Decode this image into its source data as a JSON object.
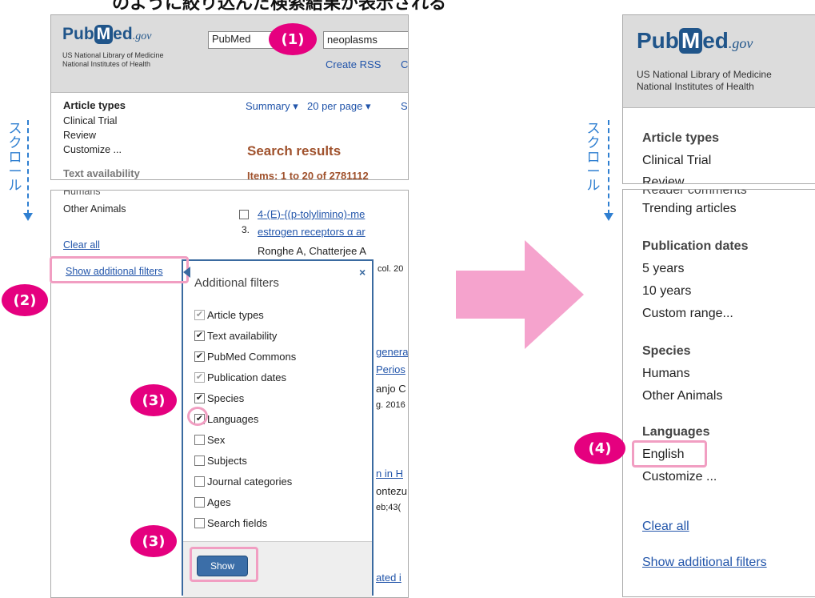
{
  "caption": "のように絞り込んだ検索結果が表示される",
  "left": {
    "logo": {
      "pub": "Pub",
      "m": "M",
      "ed": "ed",
      "gov": ".gov"
    },
    "nlm_line1": "US National Library of Medicine",
    "nlm_line2": "National Institutes of Health",
    "db_select": "PubMed",
    "search_value": "neoplasms",
    "create_rss": "Create RSS",
    "create_rss_cut": "C",
    "sidebar": {
      "article_types": "Article types",
      "clinical_trial": "Clinical Trial",
      "review": "Review",
      "customize": "Customize ...",
      "humans": "Humans",
      "other_animals": "Other Animals",
      "clear_all": "Clear all",
      "show_additional_filters": "Show additional filters"
    },
    "toolbar": {
      "summary": "Summary",
      "per_page": "20 per page",
      "cut": "S"
    },
    "search_results": "Search results",
    "items": "Items: 1 to 20 of 2781112",
    "results": [
      {
        "num": "3.",
        "line1": "4-(E)-{(p-tolylimino)-me",
        "line2": "estrogen receptors α ar",
        "authors": "Ronghe A, Chatterjee A",
        "journal": "col. 20"
      },
      {
        "line1": "genera",
        "line2": "Perios",
        "authors": "anjo C",
        "journal": "g. 2016"
      },
      {
        "line1": "n in H",
        "authors": "ontezu",
        "journal": "eb;43("
      },
      {
        "line1": "ated i"
      }
    ],
    "popup": {
      "title": "Additional filters",
      "close": "×",
      "options": [
        {
          "label": "Article types",
          "checked": true,
          "disabled": true
        },
        {
          "label": "Text availability",
          "checked": true,
          "disabled": false
        },
        {
          "label": "PubMed Commons",
          "checked": true,
          "disabled": false
        },
        {
          "label": "Publication dates",
          "checked": true,
          "disabled": true
        },
        {
          "label": "Species",
          "checked": true,
          "disabled": false
        },
        {
          "label": "Languages",
          "checked": true,
          "disabled": false
        },
        {
          "label": "Sex",
          "checked": false,
          "disabled": false
        },
        {
          "label": "Subjects",
          "checked": false,
          "disabled": false
        },
        {
          "label": "Journal categories",
          "checked": false,
          "disabled": false
        },
        {
          "label": "Ages",
          "checked": false,
          "disabled": false
        },
        {
          "label": "Search fields",
          "checked": false,
          "disabled": false
        }
      ],
      "show_button": "Show"
    }
  },
  "right": {
    "nlm_line1": "US National Library of Medicine",
    "nlm_line2": "National Institutes of Health",
    "article_types": "Article types",
    "clinical_trial": "Clinical Trial",
    "reader_comments": "Reader comments",
    "trending": "Trending articles",
    "pub_dates": "Publication dates",
    "y5": "5 years",
    "y10": "10 years",
    "custom_range": "Custom range...",
    "species": "Species",
    "humans": "Humans",
    "other_animals": "Other Animals",
    "languages": "Languages",
    "english": "English",
    "customize": "Customize ...",
    "clear_all": "Clear all",
    "show_additional_filters": "Show additional filters"
  },
  "annotations": {
    "n1": "(1)",
    "n2": "(2)",
    "n3a": "(3)",
    "n3b": "(3)",
    "n4": "(4)",
    "scroll": [
      "ス",
      "ク",
      "ロ",
      "ー",
      "ル"
    ]
  },
  "colors": {
    "accent_pink": "#e5007f",
    "highlight_pink": "#f19ec2",
    "arrow_pink": "#f5a3cd",
    "scroll_blue": "#2f7fd1",
    "pubmed_blue": "#20558a"
  }
}
